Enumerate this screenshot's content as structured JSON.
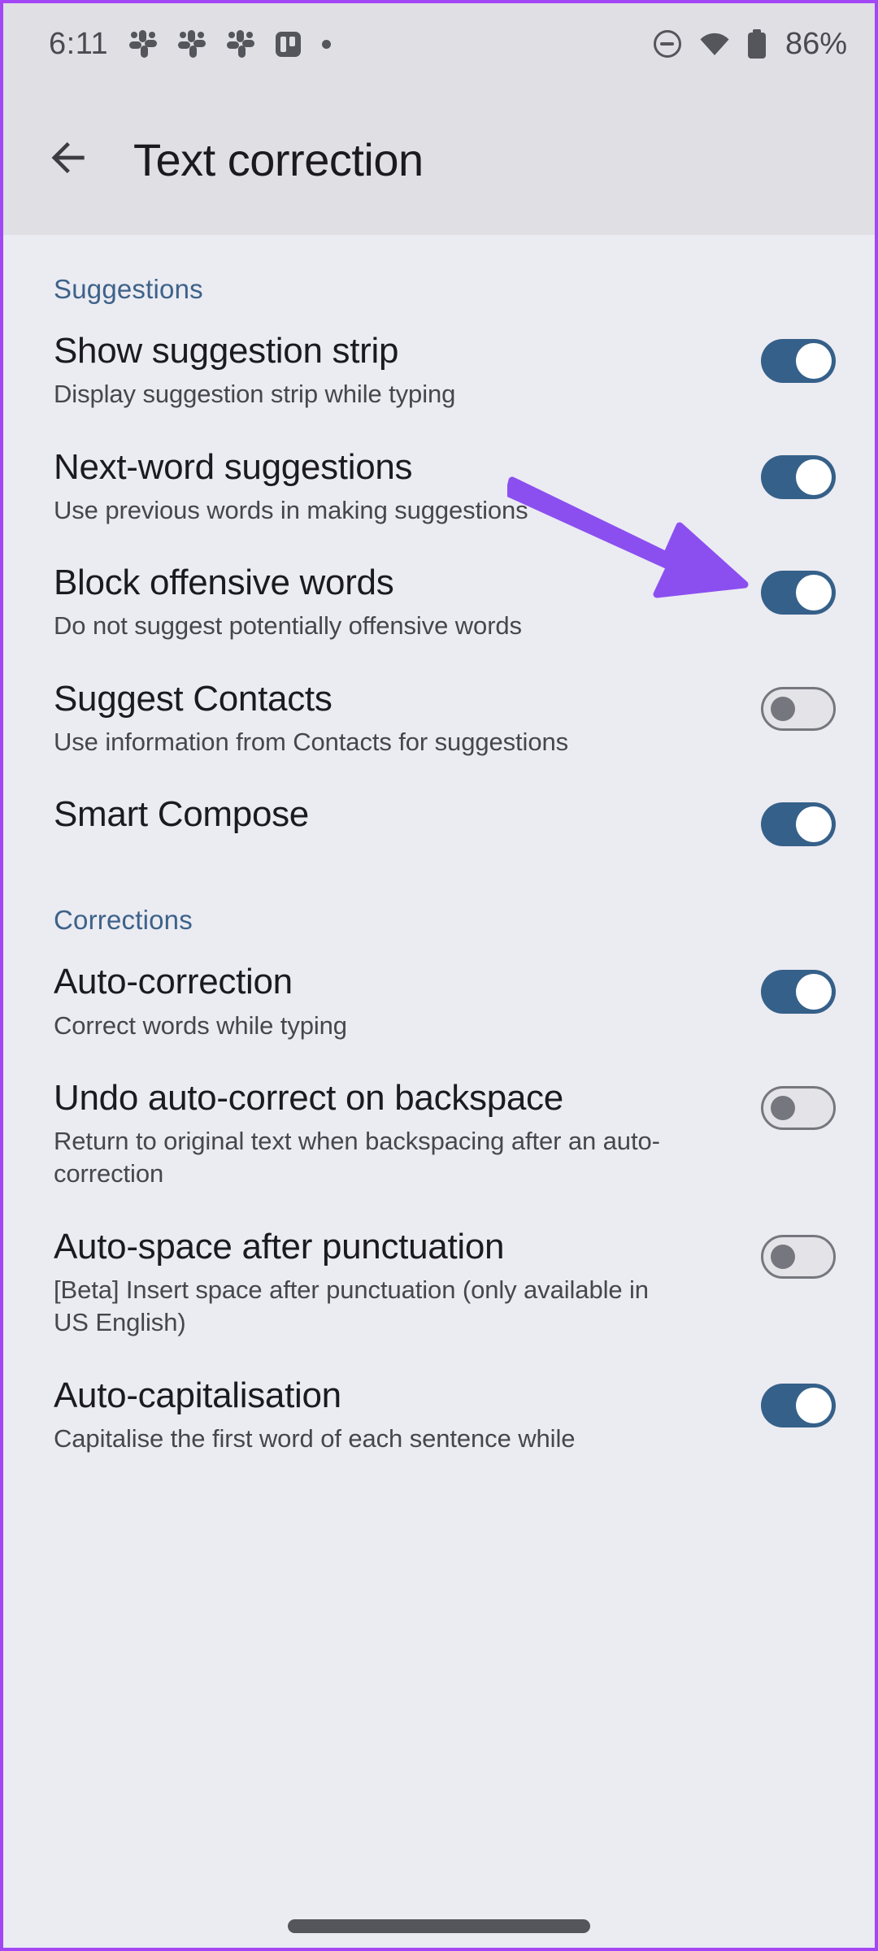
{
  "statusbar": {
    "time": "6:11",
    "battery_percent": "86%",
    "left_icons": [
      "slack-icon",
      "slack-icon",
      "slack-icon",
      "trello-icon",
      "dot-icon"
    ],
    "right_icons": [
      "do-not-disturb-icon",
      "wifi-icon",
      "battery-icon"
    ]
  },
  "appbar": {
    "back_icon": "back-arrow-icon",
    "title": "Text correction"
  },
  "colors": {
    "accent_blue": "#356089",
    "section_header": "#3D6289",
    "annotation_purple": "#8B4FF0",
    "appbar_bg": "#DFDFE4",
    "content_bg": "#EBEBF2"
  },
  "sections": [
    {
      "header": "Suggestions",
      "rows": [
        {
          "title": "Show suggestion strip",
          "subtitle": "Display suggestion strip while typing",
          "toggle": "on"
        },
        {
          "title": "Next-word suggestions",
          "subtitle": "Use previous words in making suggestions",
          "toggle": "on"
        },
        {
          "title": "Block offensive words",
          "subtitle": "Do not suggest potentially offensive words",
          "toggle": "on"
        },
        {
          "title": "Suggest Contacts",
          "subtitle": "Use information from Contacts for suggestions",
          "toggle": "off"
        },
        {
          "title": "Smart Compose",
          "subtitle": "",
          "toggle": "on"
        }
      ]
    },
    {
      "header": "Corrections",
      "rows": [
        {
          "title": "Auto-correction",
          "subtitle": "Correct words while typing",
          "toggle": "on"
        },
        {
          "title": "Undo auto-correct on backspace",
          "subtitle": "Return to original text when backspacing after an auto-correction",
          "toggle": "off"
        },
        {
          "title": "Auto-space after punctuation",
          "subtitle": "[Beta] Insert space after punctuation (only available in US English)",
          "toggle": "off"
        },
        {
          "title": "Auto-capitalisation",
          "subtitle": "Capitalise the first word of each sentence while",
          "toggle": "on"
        }
      ]
    }
  ],
  "annotation": {
    "type": "arrow",
    "points_to": "next-word-suggestions-toggle"
  }
}
